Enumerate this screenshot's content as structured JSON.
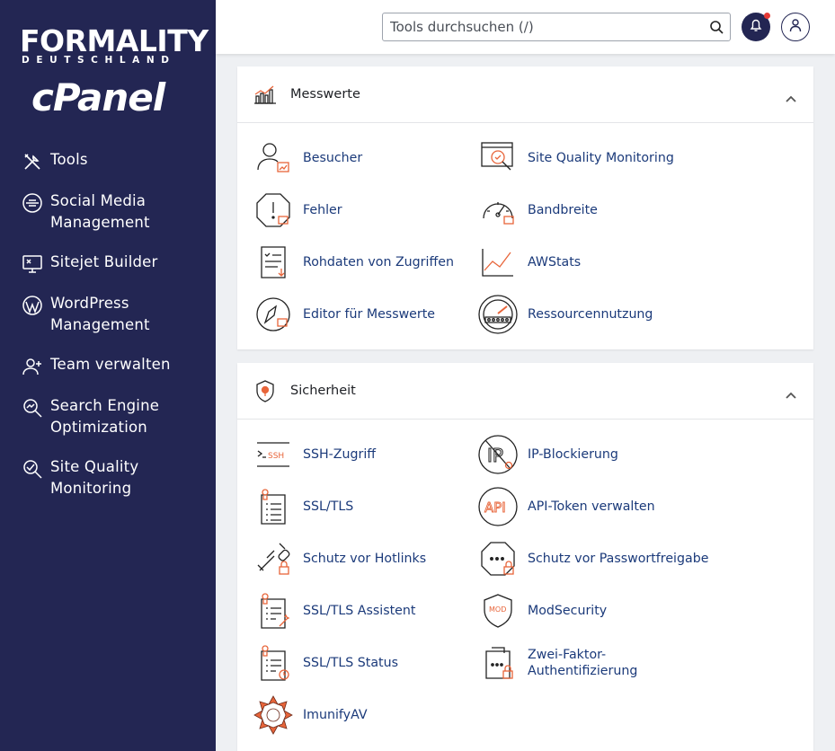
{
  "brand": {
    "name": "FORMALITY",
    "subtitle": "DEUTSCHLAND",
    "product": "cPanel"
  },
  "sidebar": {
    "items": [
      {
        "label": "Tools",
        "icon": "tools-icon"
      },
      {
        "label": "Social Media Management",
        "icon": "social-media-icon"
      },
      {
        "label": "Sitejet Builder",
        "icon": "sitejet-icon"
      },
      {
        "label": "WordPress Management",
        "icon": "wordpress-icon"
      },
      {
        "label": "Team verwalten",
        "icon": "team-icon"
      },
      {
        "label": "Search Engine Optimization",
        "icon": "seo-icon"
      },
      {
        "label": "Site Quality Monitoring",
        "icon": "site-quality-icon"
      }
    ]
  },
  "header": {
    "search_placeholder": "Tools durchsuchen (/)"
  },
  "sections": [
    {
      "title": "Messwerte",
      "tools": [
        {
          "label": "Besucher",
          "icon": "visitors-icon"
        },
        {
          "label": "Site Quality Monitoring",
          "icon": "site-quality-monitoring-icon"
        },
        {
          "label": "Fehler",
          "icon": "errors-icon"
        },
        {
          "label": "Bandbreite",
          "icon": "bandwidth-icon"
        },
        {
          "label": "Rohdaten von Zugriffen",
          "icon": "raw-access-icon"
        },
        {
          "label": "AWStats",
          "icon": "awstats-icon"
        },
        {
          "label": "Editor für Messwerte",
          "icon": "metrics-editor-icon"
        },
        {
          "label": "Ressourcennutzung",
          "icon": "resource-usage-icon"
        }
      ]
    },
    {
      "title": "Sicherheit",
      "tools": [
        {
          "label": "SSH-Zugriff",
          "icon": "ssh-icon"
        },
        {
          "label": "IP-Blockierung",
          "icon": "ip-blocker-icon"
        },
        {
          "label": "SSL/TLS",
          "icon": "ssl-tls-icon"
        },
        {
          "label": "API-Token verwalten",
          "icon": "api-token-icon"
        },
        {
          "label": "Schutz vor Hotlinks",
          "icon": "hotlink-icon"
        },
        {
          "label": "Schutz vor Passwortfreigabe",
          "icon": "password-protection-icon"
        },
        {
          "label": "SSL/TLS Assistent",
          "icon": "ssl-wizard-icon"
        },
        {
          "label": "ModSecurity",
          "icon": "modsecurity-icon"
        },
        {
          "label": "SSL/TLS Status",
          "icon": "ssl-status-icon"
        },
        {
          "label": "Zwei-Faktor-Authentifizierung",
          "icon": "two-factor-icon"
        },
        {
          "label": "ImunifyAV",
          "icon": "imunifyav-icon"
        }
      ]
    }
  ],
  "icon_text": {
    "ssh": "SSH",
    "ip": "IP",
    "api": "API",
    "mod": "MOD"
  },
  "colors": {
    "sidebar": "#232653",
    "link": "#1b3a7a",
    "accent": "#e8653a"
  }
}
